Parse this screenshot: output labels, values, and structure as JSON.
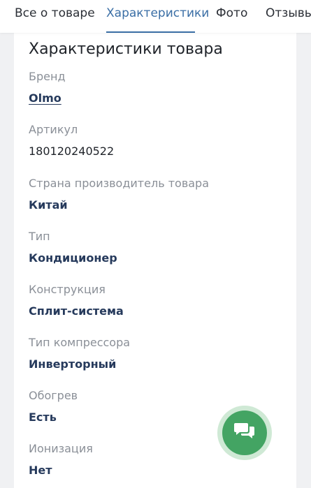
{
  "tabs": [
    {
      "label": "Все о товаре",
      "active": false
    },
    {
      "label": "Характеристики",
      "active": true
    },
    {
      "label": "Фото",
      "active": false
    },
    {
      "label": "Отзывы",
      "active": false
    }
  ],
  "section": {
    "title": "Характеристики товара",
    "specs": [
      {
        "label": "Бренд",
        "value": "Olmo"
      },
      {
        "label": "Артикул",
        "value": "180120240522"
      },
      {
        "label": "Страна производитель товара",
        "value": "Китай"
      },
      {
        "label": "Тип",
        "value": "Кондиционер"
      },
      {
        "label": "Конструкция",
        "value": "Сплит-система"
      },
      {
        "label": "Тип компрессора",
        "value": "Инверторный"
      },
      {
        "label": "Обогрев",
        "value": "Есть"
      },
      {
        "label": "Ионизация",
        "value": "Нет"
      }
    ]
  },
  "chat_button": {
    "icon": "chat-bubbles-icon"
  },
  "colors": {
    "accent": "#3a6ea5",
    "value_text": "#263a5c",
    "label_text": "#8a8f97",
    "chat_green": "#43a463",
    "chat_halo": "#cfe9d5"
  }
}
